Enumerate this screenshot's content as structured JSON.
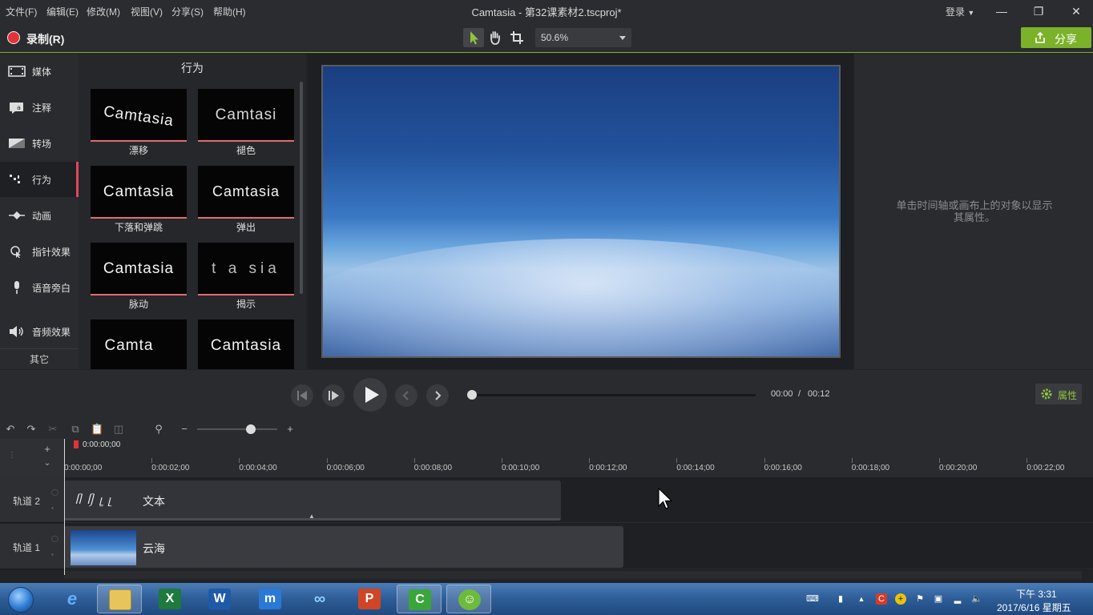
{
  "menu": {
    "file": "文件(F)",
    "edit": "编辑(E)",
    "modify": "修改(M)",
    "view": "视图(V)",
    "share": "分享(S)",
    "help": "帮助(H)"
  },
  "window": {
    "title": "Camtasia - 第32课素材2.tscproj*",
    "login": "登录"
  },
  "toolbar": {
    "record_label": "录制(R)",
    "zoom_value": "50.6%",
    "share_label": "分享",
    "accent_color": "#7cb22a",
    "record_color": "#e3323a"
  },
  "sidebar": {
    "items": [
      {
        "label": "媒体",
        "icon": "film-icon"
      },
      {
        "label": "注释",
        "icon": "annotation-icon"
      },
      {
        "label": "转场",
        "icon": "transition-icon"
      },
      {
        "label": "行为",
        "icon": "behavior-icon"
      },
      {
        "label": "动画",
        "icon": "animation-icon"
      },
      {
        "label": "指针效果",
        "icon": "cursor-effect-icon"
      },
      {
        "label": "语音旁白",
        "icon": "microphone-icon"
      },
      {
        "label": "音频效果",
        "icon": "speaker-icon"
      }
    ],
    "other": "其它",
    "active": "行为"
  },
  "behaviors": {
    "title": "行为",
    "tiles": [
      {
        "preview": "Camtasia",
        "label": "漂移"
      },
      {
        "preview": "Camtasi",
        "label": "褪色"
      },
      {
        "preview": "Camtasia",
        "label": "下落和弹跳"
      },
      {
        "preview": "Camtasia",
        "label": "弹出"
      },
      {
        "preview": "Camtasia",
        "label": "脉动"
      },
      {
        "preview": "t a sia",
        "label": "揭示"
      },
      {
        "preview": "Camta",
        "label": ""
      },
      {
        "preview": "Camtasia",
        "label": ""
      }
    ]
  },
  "properties": {
    "empty_message": "单击时间轴或画布上的对象以显示其属性。"
  },
  "playback": {
    "current_time": "00:00",
    "separator": "/",
    "total_time": "00:12",
    "properties_button": "属性"
  },
  "timeline": {
    "playhead_time": "0:00:00;00",
    "ticks": [
      "0:00:00;00",
      "0:00:02;00",
      "0:00:04;00",
      "0:00:06;00",
      "0:00:08;00",
      "0:00:10;00",
      "0:00:12;00",
      "0:00:14;00",
      "0:00:16;00",
      "0:00:18;00",
      "0:00:20;00",
      "0:00:22;00"
    ],
    "tracks": [
      {
        "name": "轨道 2",
        "clip_label": "文本"
      },
      {
        "name": "轨道 1",
        "clip_label": "云海"
      }
    ]
  },
  "taskbar": {
    "apps": [
      {
        "icon": "start-orb-icon"
      },
      {
        "icon": "internet-explorer-icon"
      },
      {
        "icon": "file-explorer-icon"
      },
      {
        "icon": "excel-icon"
      },
      {
        "icon": "word-icon"
      },
      {
        "icon": "maxthon-icon"
      },
      {
        "icon": "baidu-cloud-icon"
      },
      {
        "icon": "powerpoint-icon"
      },
      {
        "icon": "camtasia-icon"
      },
      {
        "icon": "green-app-icon"
      }
    ],
    "clock_time": "下午 3:31",
    "clock_date": "2017/6/16 星期五"
  }
}
